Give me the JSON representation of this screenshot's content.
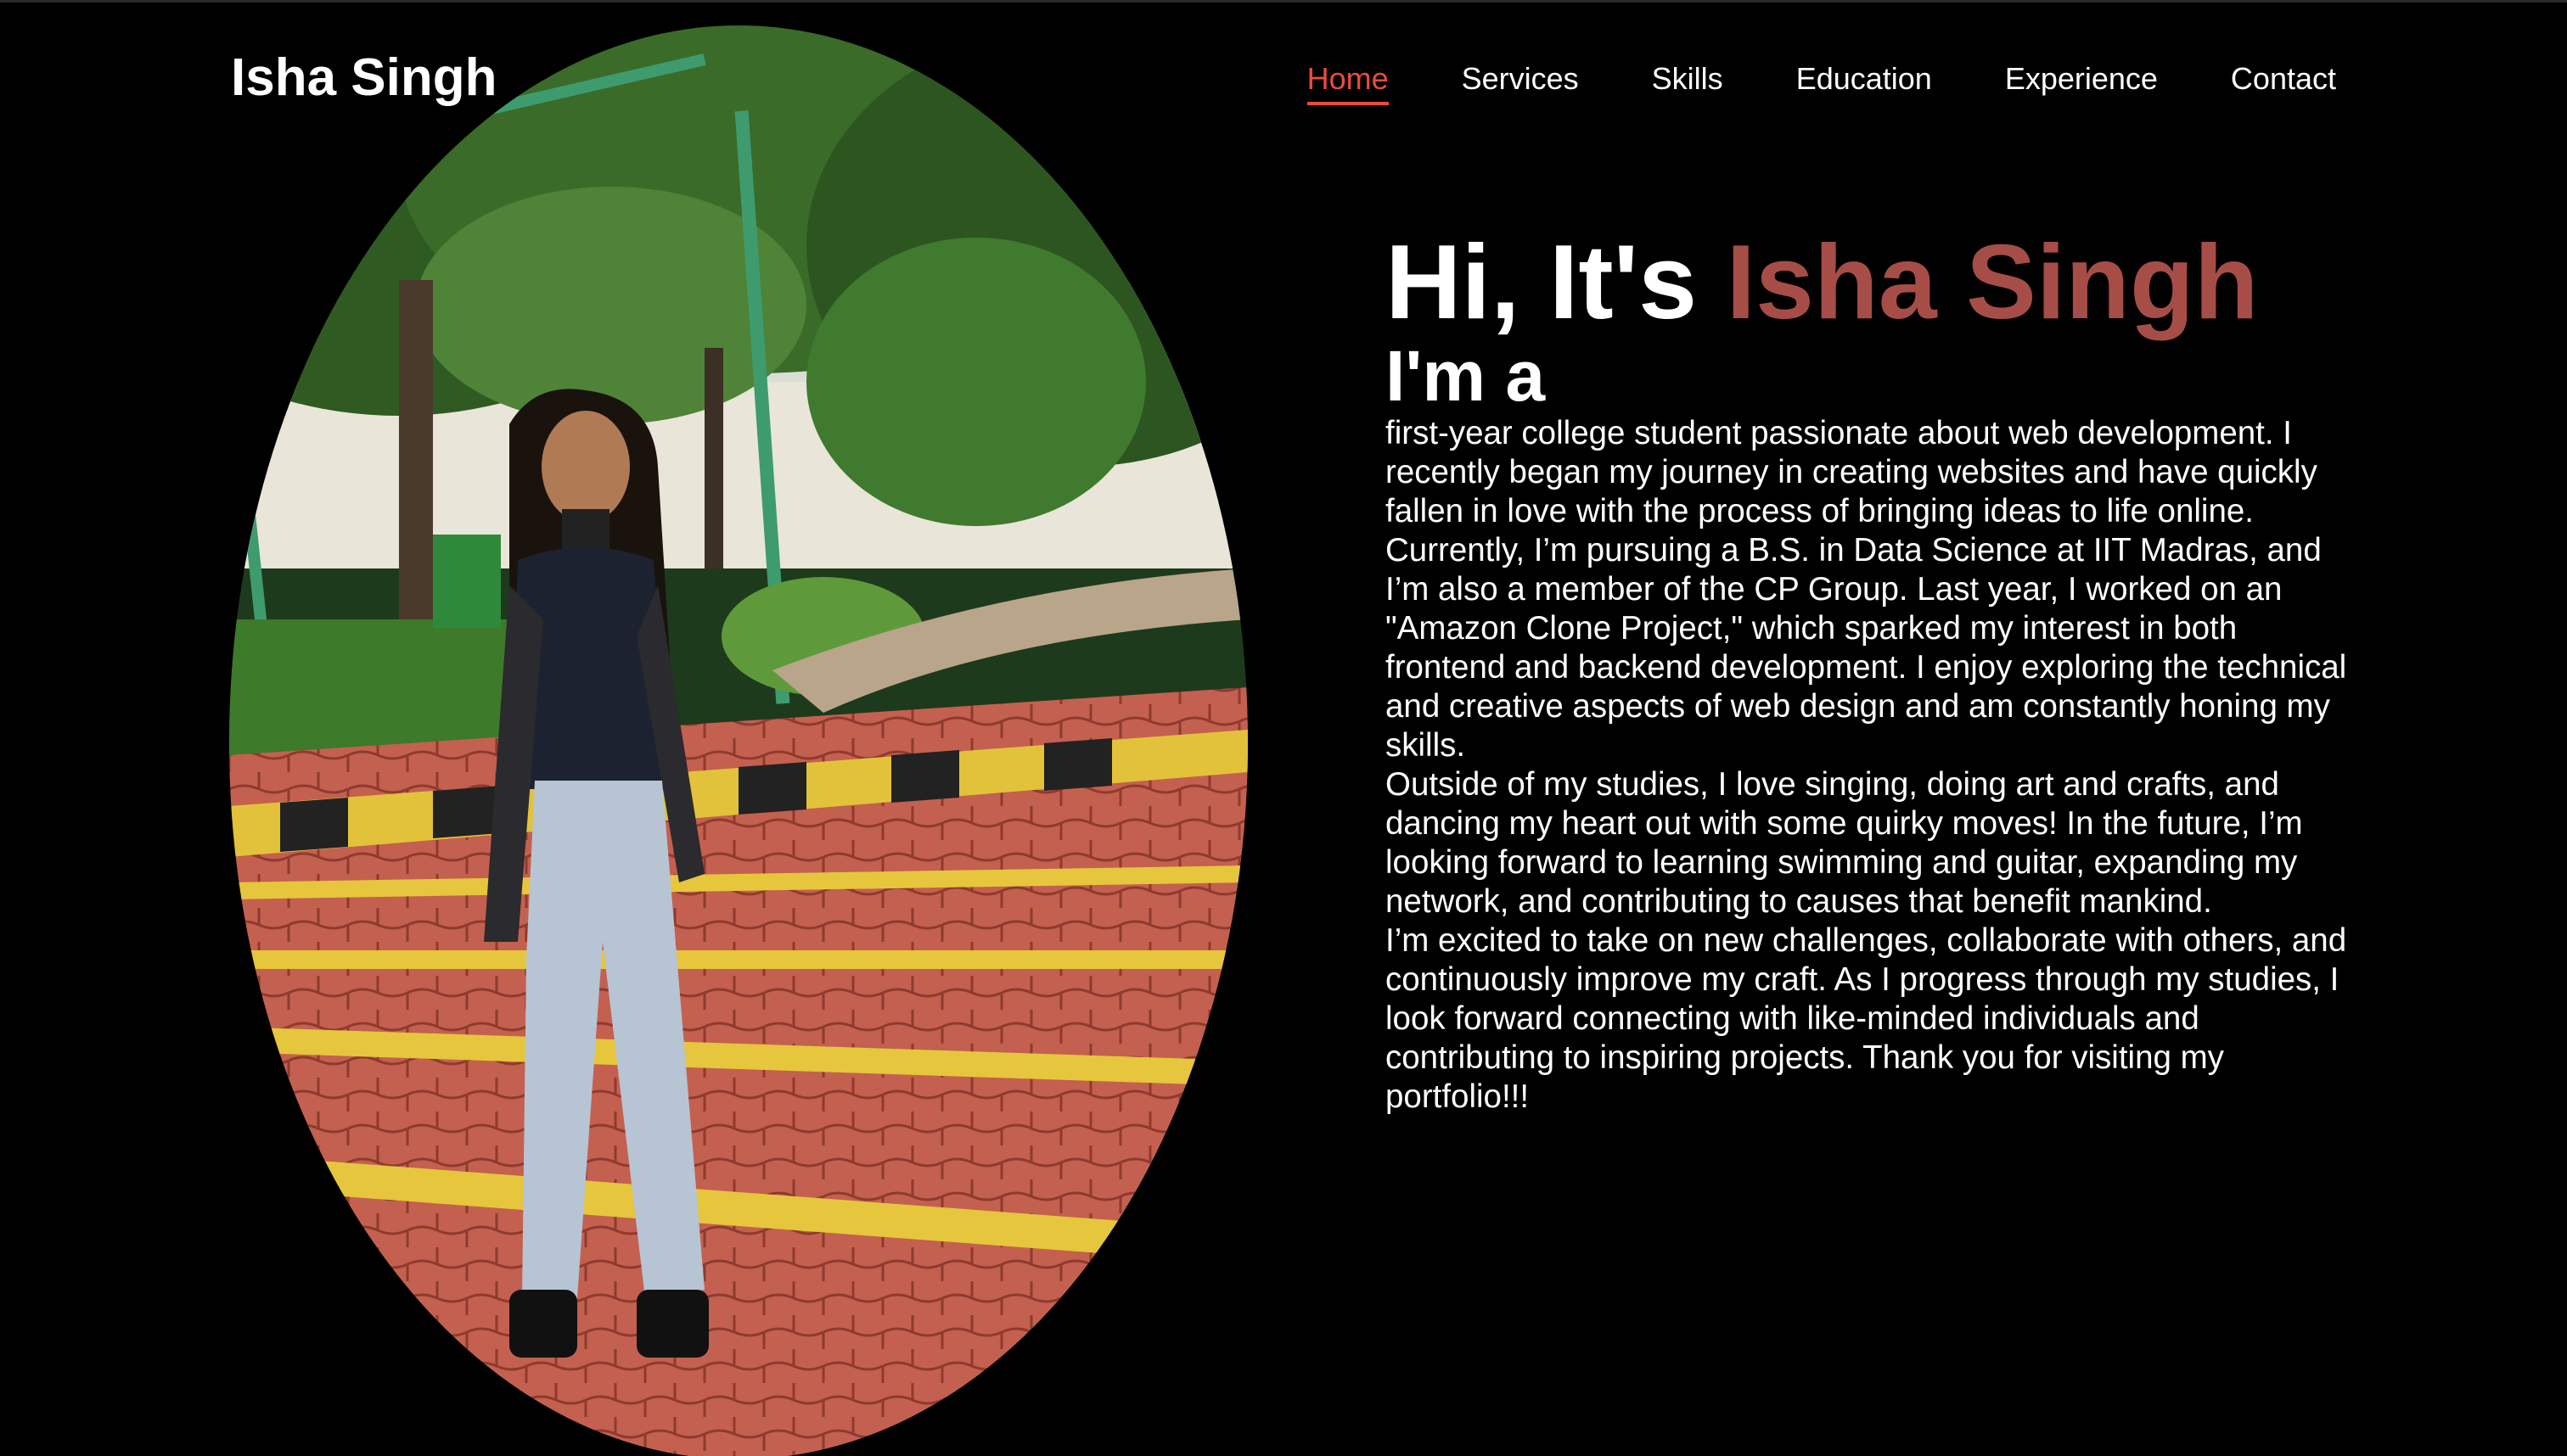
{
  "header": {
    "logo": "Isha Singh",
    "nav": [
      {
        "label": "Home",
        "active": true
      },
      {
        "label": "Services",
        "active": false
      },
      {
        "label": "Skills",
        "active": false
      },
      {
        "label": "Education",
        "active": false
      },
      {
        "label": "Experience",
        "active": false
      },
      {
        "label": "Contact",
        "active": false
      }
    ]
  },
  "hero": {
    "greeting": "Hi, It's ",
    "name": "Isha Singh",
    "role_prefix": "I'm a",
    "bio": [
      "first-year college student passionate about web development. I recently began my journey in creating websites and have quickly fallen in love with the process of bringing ideas to life online.",
      "Currently, I’m pursuing a B.S. in Data Science at IIT Madras, and I’m also a member of the CP Group. Last year, I worked on an \"Amazon Clone Project,\" which sparked my interest in both frontend and backend development. I enjoy exploring the technical and creative aspects of web design and am constantly honing my skills.",
      "Outside of my studies, I love singing, doing art and crafts, and dancing my heart out with some quirky moves! In the future, I’m looking forward to learning swimming and guitar, expanding my network, and contributing to causes that benefit mankind.",
      "I’m excited to take on new challenges, collaborate with others, and continuously improve my craft. As I progress through my studies, I look forward connecting with like-minded individuals and contributing to inspiring projects. Thank you for visiting my portfolio!!!"
    ]
  },
  "colors": {
    "background": "#000000",
    "accent_nav": "#e84c3d",
    "accent_name": "#a64d48",
    "text": "#ffffff"
  },
  "photo": {
    "icon": "profile-photo"
  }
}
